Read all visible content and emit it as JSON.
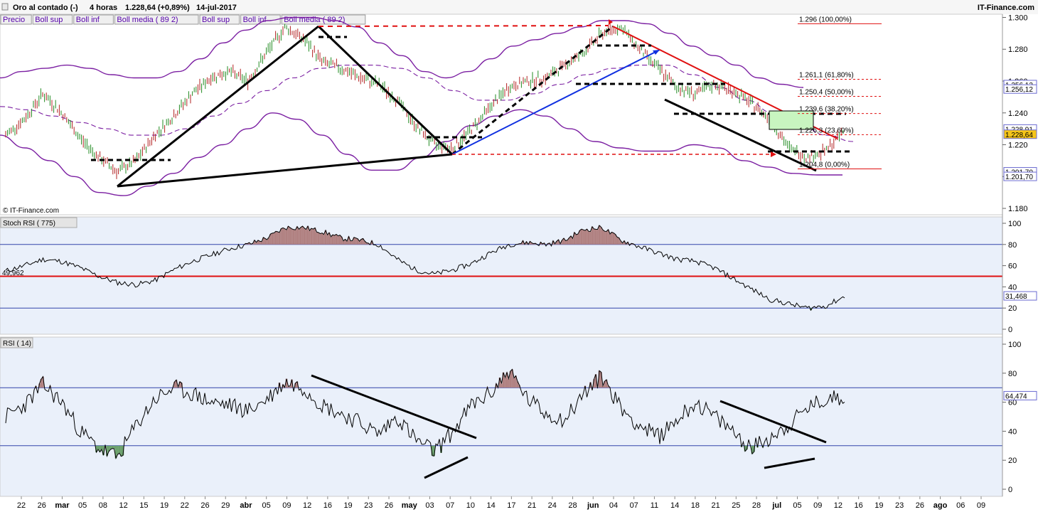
{
  "header": {
    "instrument": "Oro al contado (-)",
    "timeframe": "4 horas",
    "price_change": "1.228,64 (+0,89%)",
    "date": "14-jul-2017",
    "brand": "IT-Finance.com",
    "watermark": "© IT-Finance.com"
  },
  "legend": [
    "Precio",
    "Boll sup",
    "Boll inf",
    "Boll media ( 89 2)",
    "Boll sup",
    "Boll inf",
    "Boll media ( 89 2)"
  ],
  "colors": {
    "price_up": "#228b22",
    "price_down": "#b22222",
    "bollinger": "#7b1fa2",
    "trend_blue": "#1030e0",
    "trend_red": "#e01010",
    "trend_black": "#000000",
    "panel_bg": "#eaf0fa",
    "overbought_fill": "#b08080",
    "oversold_fill": "#6aa06a"
  },
  "x_axis": {
    "labels": [
      "22",
      "26",
      "mar",
      "05",
      "08",
      "12",
      "15",
      "19",
      "22",
      "26",
      "29",
      "abr",
      "05",
      "09",
      "12",
      "16",
      "19",
      "23",
      "26",
      "may",
      "03",
      "07",
      "10",
      "14",
      "17",
      "21",
      "24",
      "28",
      "jun",
      "04",
      "07",
      "11",
      "14",
      "18",
      "21",
      "25",
      "28",
      "jul",
      "05",
      "09",
      "12",
      "16",
      "19",
      "23",
      "26",
      "ago",
      "06",
      "09"
    ]
  },
  "price_panel": {
    "y_ticks": [
      "1.300",
      "1.280",
      "1.260",
      "1.240",
      "1.220",
      "1.200",
      "1.180"
    ],
    "last_price": "1.228,64",
    "side_labels": [
      "1.256,12",
      "1.256,12",
      "1.228,91",
      "1.228,64",
      "1.201,70",
      "1.201,70"
    ],
    "fib_levels": [
      {
        "label": "1.296 (100,00%)",
        "value": 1296.0
      },
      {
        "label": "1.261,1 (61,80%)",
        "value": 1261.1
      },
      {
        "label": "1.250,4 (50,00%)",
        "value": 1250.4
      },
      {
        "label": "1.239,6 (38,20%)",
        "value": 1239.6
      },
      {
        "label": "1.226,3 (23,60%)",
        "value": 1226.3
      },
      {
        "label": "1.204,8 (0,00%)",
        "value": 1204.8
      }
    ]
  },
  "stoch_panel": {
    "title": "Stoch RSI ( 775)",
    "y_ticks": [
      "100",
      "80",
      "60",
      "40",
      "20",
      "0"
    ],
    "left_value": "49,962",
    "last_value": "31,468"
  },
  "rsi_panel": {
    "title": "RSI ( 14)",
    "y_ticks": [
      "100",
      "80",
      "60",
      "40",
      "20",
      "0"
    ],
    "last_value": "64,474"
  },
  "chart_data": [
    {
      "type": "line",
      "title": "Oro al contado (-)",
      "series": [
        {
          "name": "Precio",
          "values": [
            1226,
            1236,
            1252,
            1240,
            1224,
            1212,
            1203,
            1210,
            1226,
            1238,
            1252,
            1262,
            1266,
            1260,
            1278,
            1294,
            1286,
            1272,
            1268,
            1262,
            1258,
            1248,
            1232,
            1220,
            1218,
            1230,
            1244,
            1256,
            1260,
            1262,
            1270,
            1278,
            1290,
            1294,
            1280,
            1268,
            1256,
            1252,
            1258,
            1254,
            1246,
            1236,
            1218,
            1212,
            1216,
            1229
          ]
        },
        {
          "name": "Boll sup",
          "values": [
            1262,
            1266,
            1268,
            1270,
            1268,
            1264,
            1262,
            1262,
            1266,
            1274,
            1284,
            1292,
            1298,
            1300,
            1300,
            1298,
            1294,
            1284,
            1276,
            1266,
            1262,
            1266,
            1274,
            1282,
            1286,
            1290,
            1294,
            1298,
            1298,
            1296,
            1290,
            1282,
            1276,
            1270,
            1262,
            1258,
            1256
          ]
        },
        {
          "name": "Boll inf",
          "values": [
            1226,
            1218,
            1210,
            1200,
            1190,
            1188,
            1194,
            1202,
            1212,
            1220,
            1230,
            1240,
            1236,
            1226,
            1214,
            1204,
            1204,
            1212,
            1222,
            1232,
            1238,
            1242,
            1238,
            1230,
            1222,
            1218,
            1216,
            1216,
            1220,
            1218,
            1210,
            1206,
            1202,
            1201,
            1201
          ]
        },
        {
          "name": "Boll media ( 89 2)",
          "values": [
            1244,
            1242,
            1238,
            1234,
            1230,
            1226,
            1226,
            1230,
            1238,
            1246,
            1254,
            1262,
            1268,
            1270,
            1270,
            1268,
            1262,
            1254,
            1248,
            1248,
            1252,
            1258,
            1264,
            1268,
            1270,
            1270,
            1264,
            1256,
            1248,
            1240,
            1232,
            1226,
            1222
          ]
        }
      ],
      "ylim": [
        1176,
        1302
      ]
    },
    {
      "type": "line",
      "title": "Stoch RSI ( 775)",
      "series": [
        {
          "name": "Stoch RSI",
          "values": [
            55,
            60,
            66,
            64,
            58,
            50,
            44,
            42,
            46,
            56,
            64,
            70,
            76,
            80,
            86,
            96,
            96,
            92,
            86,
            84,
            80,
            66,
            56,
            52,
            56,
            62,
            72,
            80,
            82,
            80,
            84,
            94,
            96,
            84,
            78,
            72,
            66,
            64,
            58,
            48,
            38,
            28,
            24,
            20,
            22,
            31
          ]
        }
      ],
      "ylim": [
        0,
        100
      ]
    },
    {
      "type": "line",
      "title": "RSI ( 14)",
      "series": [
        {
          "name": "RSI",
          "values": [
            50,
            58,
            72,
            60,
            40,
            28,
            22,
            44,
            62,
            70,
            66,
            60,
            58,
            54,
            62,
            74,
            70,
            58,
            52,
            46,
            38,
            50,
            34,
            26,
            40,
            58,
            66,
            82,
            62,
            52,
            48,
            66,
            78,
            56,
            44,
            36,
            48,
            60,
            50,
            40,
            28,
            36,
            44,
            56,
            62,
            64.5
          ]
        }
      ],
      "ylim": [
        0,
        100
      ]
    }
  ]
}
